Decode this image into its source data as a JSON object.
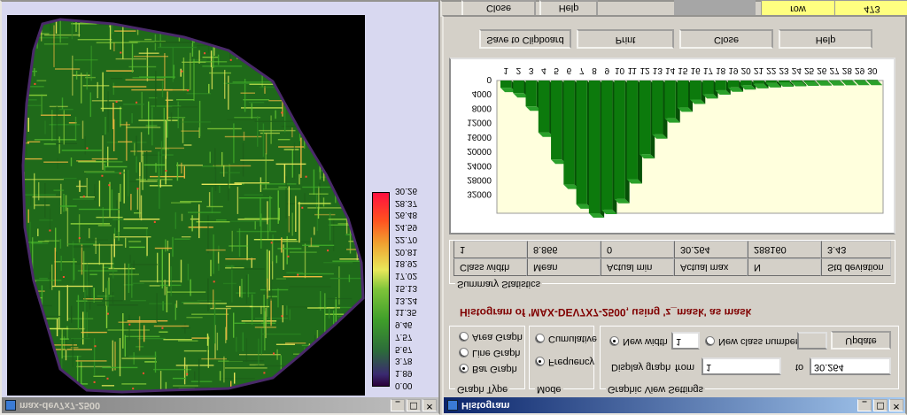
{
  "map_window": {
    "title": "max-dev7x7-2500",
    "colors": {
      "background": "#000000",
      "frame": "#ffffff",
      "ramp_low": "#3a004a",
      "ramp_mid": "#3faa28",
      "ramp_high": "#ff2040"
    },
    "legend": [
      "0.00",
      "1.89",
      "3.78",
      "5.67",
      "7.57",
      "9.46",
      "11.35",
      "13.24",
      "15.13",
      "17.02",
      "18.92",
      "20.81",
      "22.70",
      "24.59",
      "26.48",
      "28.37",
      "30.26"
    ]
  },
  "histogram_window": {
    "title": "Histogram",
    "buttons": {
      "save": "Save to Clipboard",
      "print": "Print",
      "close": "Close",
      "help": "Help"
    },
    "title_text": "Histogram of 'MAX-DEV7X7-2500, using 'z_mask' as mask",
    "summary": {
      "group_label": "Summary Statistics",
      "headers": [
        "Class width",
        "Mean",
        "Actual min",
        "Actual max",
        "N",
        "Std deviation"
      ],
      "values": [
        "1",
        "8.866",
        "0",
        "30.264",
        "288160",
        "3.43"
      ]
    },
    "graph_type": {
      "label": "Graph Type",
      "options": [
        "Bar Graph",
        "Line Graph",
        "Area Graph"
      ],
      "selected": "Bar Graph"
    },
    "mode": {
      "label": "Mode",
      "options": [
        "Frequency",
        "Cumulative"
      ],
      "selected": "Frequency"
    },
    "view_settings": {
      "label": "Graphic View Settings",
      "display_graph": "Display graph",
      "from_label": "from",
      "from_value": "1",
      "to_label": "to",
      "to_value": "30.264",
      "new_width_label": "New width",
      "new_width_value": "1",
      "new_class_label": "New class number",
      "new_class_value": "",
      "update": "Update",
      "width_mode": "New width"
    },
    "colors": {
      "bar": "#0c7a0c",
      "plot_bg": "#ffffdd",
      "title_text": "#800000"
    }
  },
  "background_window": {
    "buttons": {
      "close": "Close",
      "help": "Help"
    },
    "table": {
      "label": "row",
      "value": "473"
    }
  },
  "chart_data": {
    "type": "bar",
    "categories": [
      "1",
      "2",
      "3",
      "4",
      "5",
      "6",
      "7",
      "8",
      "9",
      "10",
      "11",
      "12",
      "13",
      "14",
      "15",
      "16",
      "17",
      "18",
      "19",
      "20",
      "21",
      "22",
      "23",
      "24",
      "25",
      "26",
      "27",
      "28",
      "29",
      "30"
    ],
    "values": [
      2000,
      3500,
      7200,
      14500,
      22000,
      29000,
      34500,
      37000,
      36000,
      33000,
      27500,
      20500,
      15000,
      10500,
      7500,
      5300,
      3800,
      2700,
      1900,
      1300,
      950,
      700,
      500,
      360,
      260,
      190,
      140,
      100,
      70,
      50
    ],
    "y_ticks": [
      "0",
      "4000",
      "8000",
      "12000",
      "16000",
      "20000",
      "24000",
      "28000",
      "32000"
    ],
    "ylim": [
      0,
      37000
    ]
  }
}
